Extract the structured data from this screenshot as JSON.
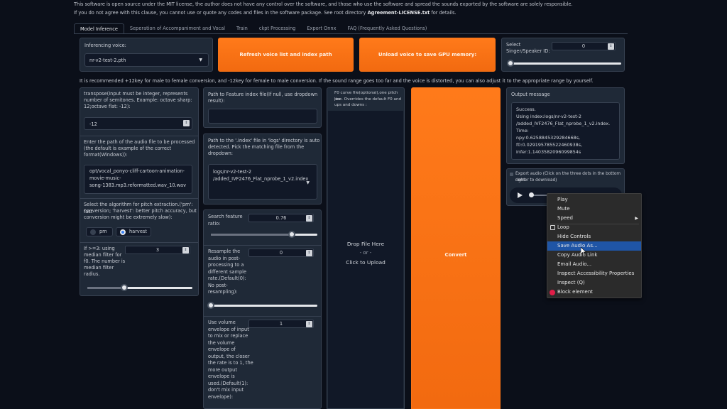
{
  "notice": {
    "line1": "This software is open source under the MIT license, the author does not have any control over the software, and those who use the software and spread the sounds exported by the software are solely responsible.",
    "line2_pre": "If you do not agree with this clause, you cannot use or quote any codes and files in the software package. See root directory ",
    "line2_bold": "Agreement-LICENSE.txt",
    "line2_post": " for details."
  },
  "tabs": [
    "Model Inference",
    "Seperation of Accompaniment and Vocal",
    "Train",
    "ckpt Processing",
    "Export Onnx",
    "FAQ (Frequently Asked Questions)"
  ],
  "voice": {
    "label": "Inferencing voice:",
    "value": "nr-v2-test-2.pth"
  },
  "buttons": {
    "refresh": "Refresh voice list and index path",
    "unload": "Unload voice to save GPU memory:",
    "convert": "Convert"
  },
  "speaker": {
    "label_1": "Select",
    "label_2": "Singer/Speaker ID:",
    "value": "0",
    "slider": 0
  },
  "tip": "It is recommended +12key for male to female conversion, and -12key for female to male conversion. If the sound range goes too far and the voice is distorted, you can also adjust it to the appropriate range by yourself.",
  "transpose": {
    "label": [
      "transpose(Input must be integer, represents",
      "number of semitones. Example: octave sharp:",
      "12;octave flat: -12):"
    ],
    "value": "-12"
  },
  "audio_path": {
    "label": [
      "Enter the path of the audio file to be processed",
      "(the default is example of the correct",
      "format(Windows)):"
    ],
    "value": [
      "opt/vocal_ponyo-cliff-cartoon-animation-",
      "movie-music-",
      "song-1383.mp3.reformatted.wav_10.wav"
    ]
  },
  "pitch_algo": {
    "label": [
      "Select the algorithm for pitch extraction.('pm': fast",
      "conversion; 'harvest': better pitch accuracy, but",
      "conversion might be extremely slow):"
    ],
    "options": [
      "pm",
      "harvest"
    ],
    "selected": "harvest"
  },
  "median": {
    "label": [
      "If >=3: using",
      "median filter for",
      "f0. The number is",
      "median filter",
      "radius."
    ],
    "value": "3",
    "slider": 0.35
  },
  "feature_path": {
    "label": [
      "Path to Feature index file(If null, use dropdown",
      "result):"
    ],
    "value": ""
  },
  "index_path": {
    "label": [
      "Path to the '.index' file in 'logs' directory is auto",
      "detected. Pick the matching file from the",
      "dropdown:"
    ],
    "value": [
      "logs/nr-v2-test-2",
      "/added_IVF2476_Flat_nprobe_1_v2.index"
    ]
  },
  "search_ratio": {
    "label": [
      "Search feature",
      "ratio:"
    ],
    "value": "0.76",
    "slider": 0.76
  },
  "resample": {
    "label": [
      "Resample the",
      "audio in post-",
      "processing to a",
      "different sample",
      "rate.(Default(0):",
      "No post-",
      "resampling):"
    ],
    "value": "0",
    "slider": 0
  },
  "volume": {
    "label": [
      "Use volume",
      "envelope of input",
      "to mix or replace",
      "the volume",
      "envelope of",
      "output, the closer",
      "the rate is to 1, the",
      "more output",
      "envelope is",
      "used.(Default(1):",
      "don't mix input",
      "envelope):"
    ],
    "value": "1"
  },
  "f0_upload": {
    "label": [
      "F0 curve file(optional),one pitch per",
      "line. Overrides the default F0 and",
      "ups and downs :"
    ],
    "drop": "Drop File Here",
    "or": "- or -",
    "click": "Click to Upload"
  },
  "output_message": {
    "label": "Output message",
    "lines": [
      "Success.",
      "Using index:logs/nr-v2-test-2",
      "/added_IVF2476_Flat_nprobe_1_v2.index.",
      "Time:",
      "npy:0.6258845329284668s,",
      "f0:0.029195785522460938s,",
      "infer:1.1403582096099854s"
    ]
  },
  "export_audio": {
    "label": [
      "Export audio (Click on the three dots in the bottom right",
      "corner to download)"
    ]
  },
  "context_menu": {
    "items": [
      "Play",
      "Mute",
      "Speed",
      "Loop",
      "Hide Controls",
      "Save Audio As...",
      "Copy Audio Link",
      "Email Audio...",
      "Inspect Accessibility Properties",
      "Inspect (Q)",
      "Block element"
    ],
    "highlighted": "Save Audio As..."
  },
  "colors": {
    "accent": "#f97316",
    "background": "#0b0f19",
    "panel": "#1f2937",
    "menu_highlight": "#1f55a6"
  }
}
